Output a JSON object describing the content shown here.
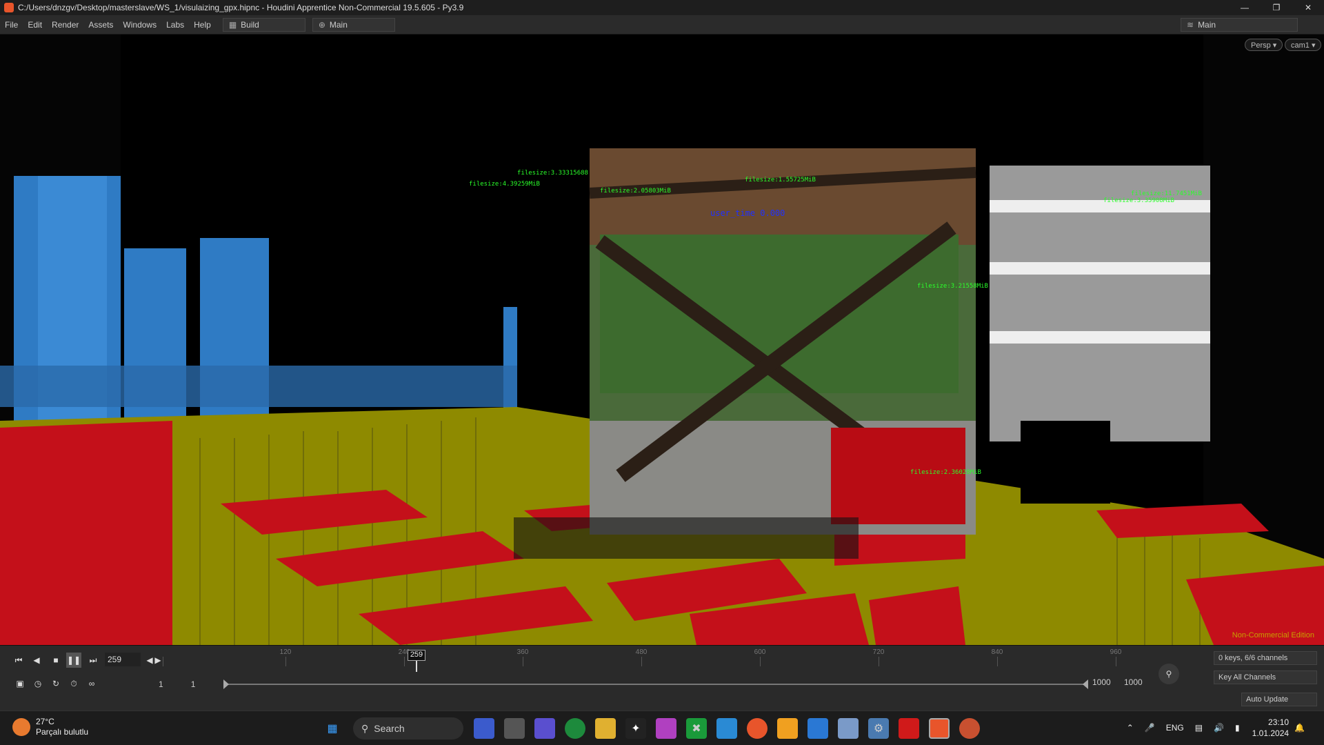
{
  "window": {
    "title": "C:/Users/dnzgv/Desktop/masterslave/WS_1/visulaizing_gpx.hipnc - Houdini Apprentice Non-Commercial 19.5.605 - Py3.9"
  },
  "menu": {
    "items": [
      "File",
      "Edit",
      "Render",
      "Assets",
      "Windows",
      "Labs",
      "Help"
    ],
    "desktop_left": "Build",
    "desktop_mid": "Main",
    "desktop_right": "Main"
  },
  "viewport": {
    "camera_menu": "Persp ▾",
    "cam_menu": "cam1 ▾",
    "watermark": "Non-Commercial Edition",
    "overlay_labels": [
      "filesize:3.33315688",
      "filesize:1.55725MiB",
      "filesize:3.35908MiB",
      "filesize:2.05803MiB",
      "filesize:4.39259MiB",
      "filesize:11.7451MiB",
      "user_time 0.000",
      "filesize:3.21558MiB",
      "filesize:2.36028MiB"
    ]
  },
  "timeline": {
    "current_frame": "259",
    "cursor_label": "259",
    "ruler_labels": [
      "120",
      "240",
      "360",
      "480",
      "600",
      "720",
      "840",
      "960"
    ],
    "range_start_a": "1",
    "range_start_b": "1",
    "range_end_a": "1000",
    "range_end_b": "1000",
    "keys_info": "0 keys, 6/6 channels",
    "key_all": "Key All Channels",
    "auto_update": "Auto Update"
  },
  "taskbar": {
    "temperature": "27°C",
    "weather_desc": "Parçalı bulutlu",
    "search_label": "Search",
    "language": "ENG",
    "time": "23:10",
    "date": "1.01.2024"
  },
  "colors": {
    "building_blue": "#2f7bc4",
    "ground_red": "#c4101a",
    "ground_olive": "#a8a000",
    "label_green": "#2aff2a",
    "label_red": "#ff2020",
    "label_blue": "#2030ff"
  }
}
